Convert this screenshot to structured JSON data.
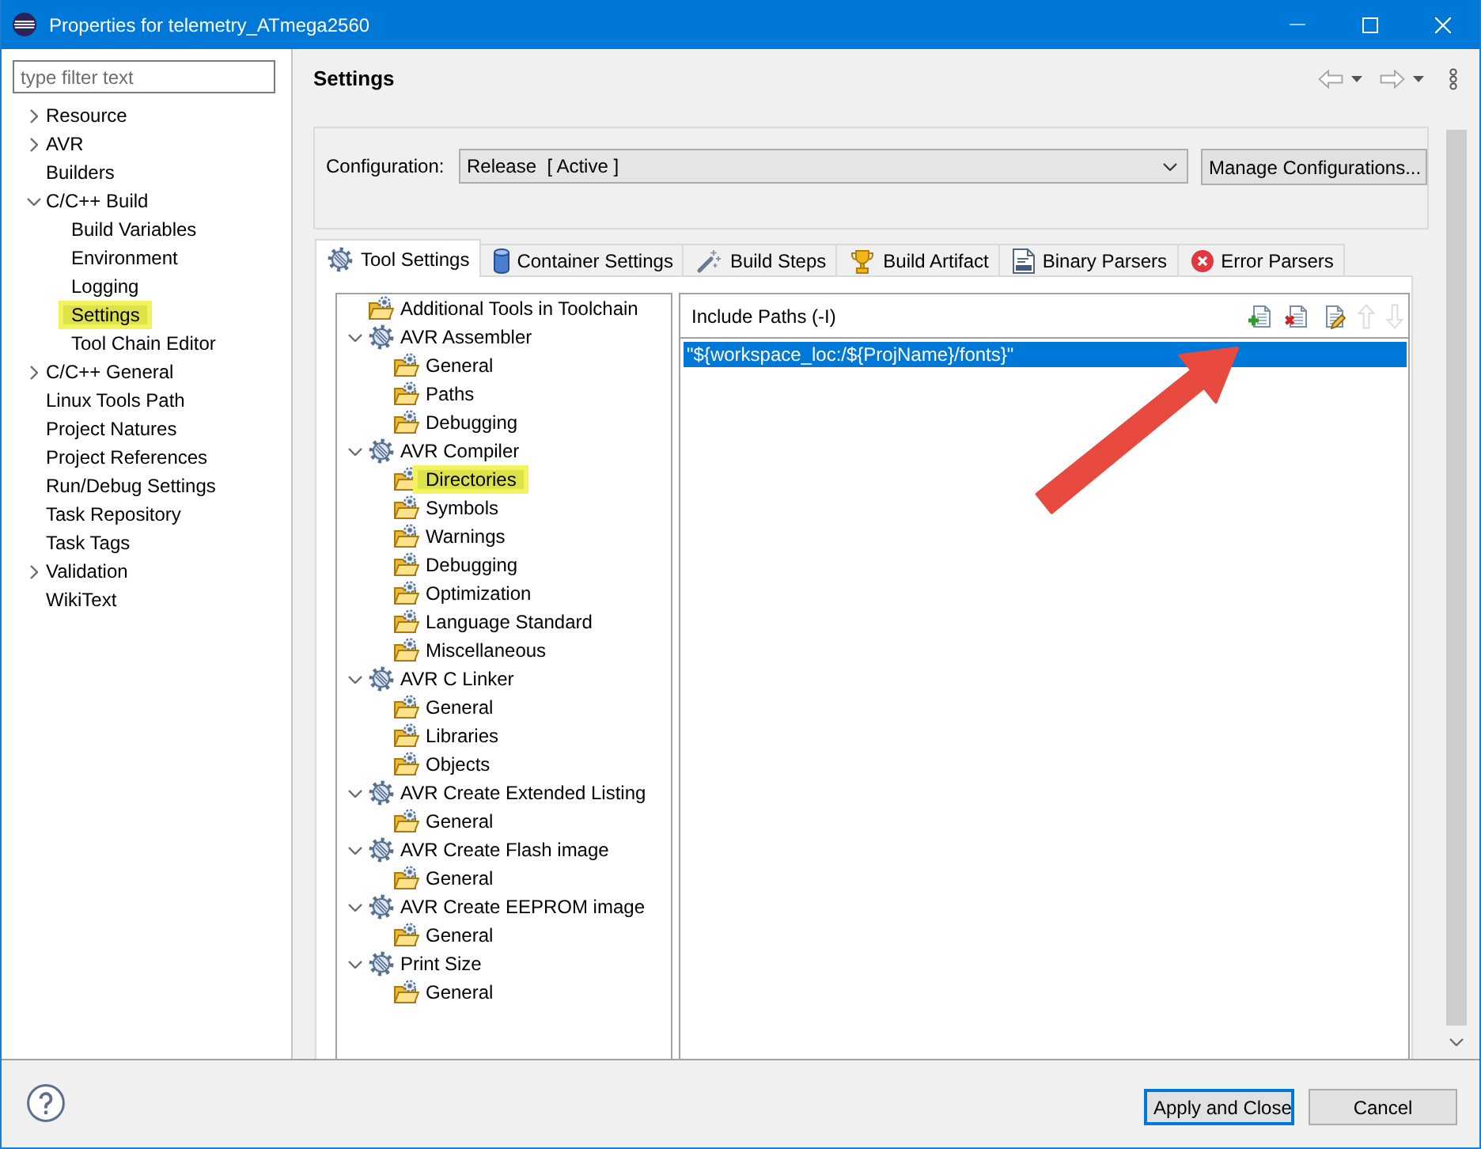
{
  "window": {
    "title": "Properties for telemetry_ATmega2560"
  },
  "filter": {
    "placeholder": "type filter text"
  },
  "sidebar": {
    "items": [
      {
        "label": "Resource",
        "kind": "group",
        "expanded": false,
        "selected": false
      },
      {
        "label": "AVR",
        "kind": "group",
        "expanded": false,
        "selected": false
      },
      {
        "label": "Builders",
        "kind": "page",
        "selected": false
      },
      {
        "label": "C/C++ Build",
        "kind": "group",
        "expanded": true,
        "selected": false,
        "children": [
          {
            "label": "Build Variables",
            "kind": "page",
            "selected": false
          },
          {
            "label": "Environment",
            "kind": "page",
            "selected": false
          },
          {
            "label": "Logging",
            "kind": "page",
            "selected": false
          },
          {
            "label": "Settings",
            "kind": "page",
            "selected": true
          },
          {
            "label": "Tool Chain Editor",
            "kind": "page",
            "selected": false
          }
        ]
      },
      {
        "label": "C/C++ General",
        "kind": "group",
        "expanded": false,
        "selected": false
      },
      {
        "label": "Linux Tools Path",
        "kind": "page",
        "selected": false
      },
      {
        "label": "Project Natures",
        "kind": "page",
        "selected": false
      },
      {
        "label": "Project References",
        "kind": "page",
        "selected": false
      },
      {
        "label": "Run/Debug Settings",
        "kind": "page",
        "selected": false
      },
      {
        "label": "Task Repository",
        "kind": "page",
        "selected": false
      },
      {
        "label": "Task Tags",
        "kind": "page",
        "selected": false
      },
      {
        "label": "Validation",
        "kind": "group",
        "expanded": false,
        "selected": false
      },
      {
        "label": "WikiText",
        "kind": "page",
        "selected": false
      }
    ]
  },
  "page": {
    "title": "Settings",
    "nav": [
      {
        "kind": "back",
        "disabled": true
      },
      {
        "kind": "forward",
        "disabled": true
      }
    ]
  },
  "configuration": {
    "label": "Configuration:",
    "value": "Release  [ Active ]",
    "manage_button": "Manage Configurations..."
  },
  "tabs": [
    {
      "label": "Tool Settings",
      "selected": true
    },
    {
      "label": "Container Settings",
      "selected": false
    },
    {
      "label": "Build Steps",
      "selected": false
    },
    {
      "label": "Build Artifact",
      "selected": false
    },
    {
      "label": "Binary Parsers",
      "selected": false
    },
    {
      "label": "Error Parsers",
      "selected": false
    }
  ],
  "tool_tree": {
    "items": [
      {
        "label": "Additional Tools in Toolchain",
        "kind": "page",
        "selected": false
      },
      {
        "label": "AVR Assembler",
        "kind": "tool",
        "expanded": true,
        "selected": false,
        "children": [
          {
            "label": "General",
            "kind": "page",
            "selected": false
          },
          {
            "label": "Paths",
            "kind": "page",
            "selected": false
          },
          {
            "label": "Debugging",
            "kind": "page",
            "selected": false
          }
        ]
      },
      {
        "label": "AVR Compiler",
        "kind": "tool",
        "expanded": true,
        "selected": false,
        "children": [
          {
            "label": "Directories",
            "kind": "page",
            "selected": true
          },
          {
            "label": "Symbols",
            "kind": "page",
            "selected": false
          },
          {
            "label": "Warnings",
            "kind": "page",
            "selected": false
          },
          {
            "label": "Debugging",
            "kind": "page",
            "selected": false
          },
          {
            "label": "Optimization",
            "kind": "page",
            "selected": false
          },
          {
            "label": "Language Standard",
            "kind": "page",
            "selected": false
          },
          {
            "label": "Miscellaneous",
            "kind": "page",
            "selected": false
          }
        ]
      },
      {
        "label": "AVR C Linker",
        "kind": "tool",
        "expanded": true,
        "selected": false,
        "children": [
          {
            "label": "General",
            "kind": "page",
            "selected": false
          },
          {
            "label": "Libraries",
            "kind": "page",
            "selected": false
          },
          {
            "label": "Objects",
            "kind": "page",
            "selected": false
          }
        ]
      },
      {
        "label": "AVR Create Extended Listing",
        "kind": "tool",
        "expanded": true,
        "selected": false,
        "children": [
          {
            "label": "General",
            "kind": "page",
            "selected": false
          }
        ]
      },
      {
        "label": "AVR Create Flash image",
        "kind": "tool",
        "expanded": true,
        "selected": false,
        "children": [
          {
            "label": "General",
            "kind": "page",
            "selected": false
          }
        ]
      },
      {
        "label": "AVR Create EEPROM image",
        "kind": "tool",
        "expanded": true,
        "selected": false,
        "children": [
          {
            "label": "General",
            "kind": "page",
            "selected": false
          }
        ]
      },
      {
        "label": "Print Size",
        "kind": "tool",
        "expanded": true,
        "selected": false,
        "children": [
          {
            "label": "General",
            "kind": "page",
            "selected": false
          }
        ]
      }
    ]
  },
  "include_paths": {
    "title": "Include Paths (-I)",
    "actions": [
      {
        "kind": "add",
        "disabled": false
      },
      {
        "kind": "delete",
        "disabled": false
      },
      {
        "kind": "edit",
        "disabled": false
      },
      {
        "kind": "up",
        "disabled": true
      },
      {
        "kind": "down",
        "disabled": true
      }
    ],
    "entries": [
      {
        "text": "\"${workspace_loc:/${ProjName}/fonts}\"",
        "selected": true
      }
    ]
  },
  "buttons": [
    {
      "label": "Apply and Close",
      "default": true
    },
    {
      "label": "Cancel",
      "default": false
    }
  ]
}
